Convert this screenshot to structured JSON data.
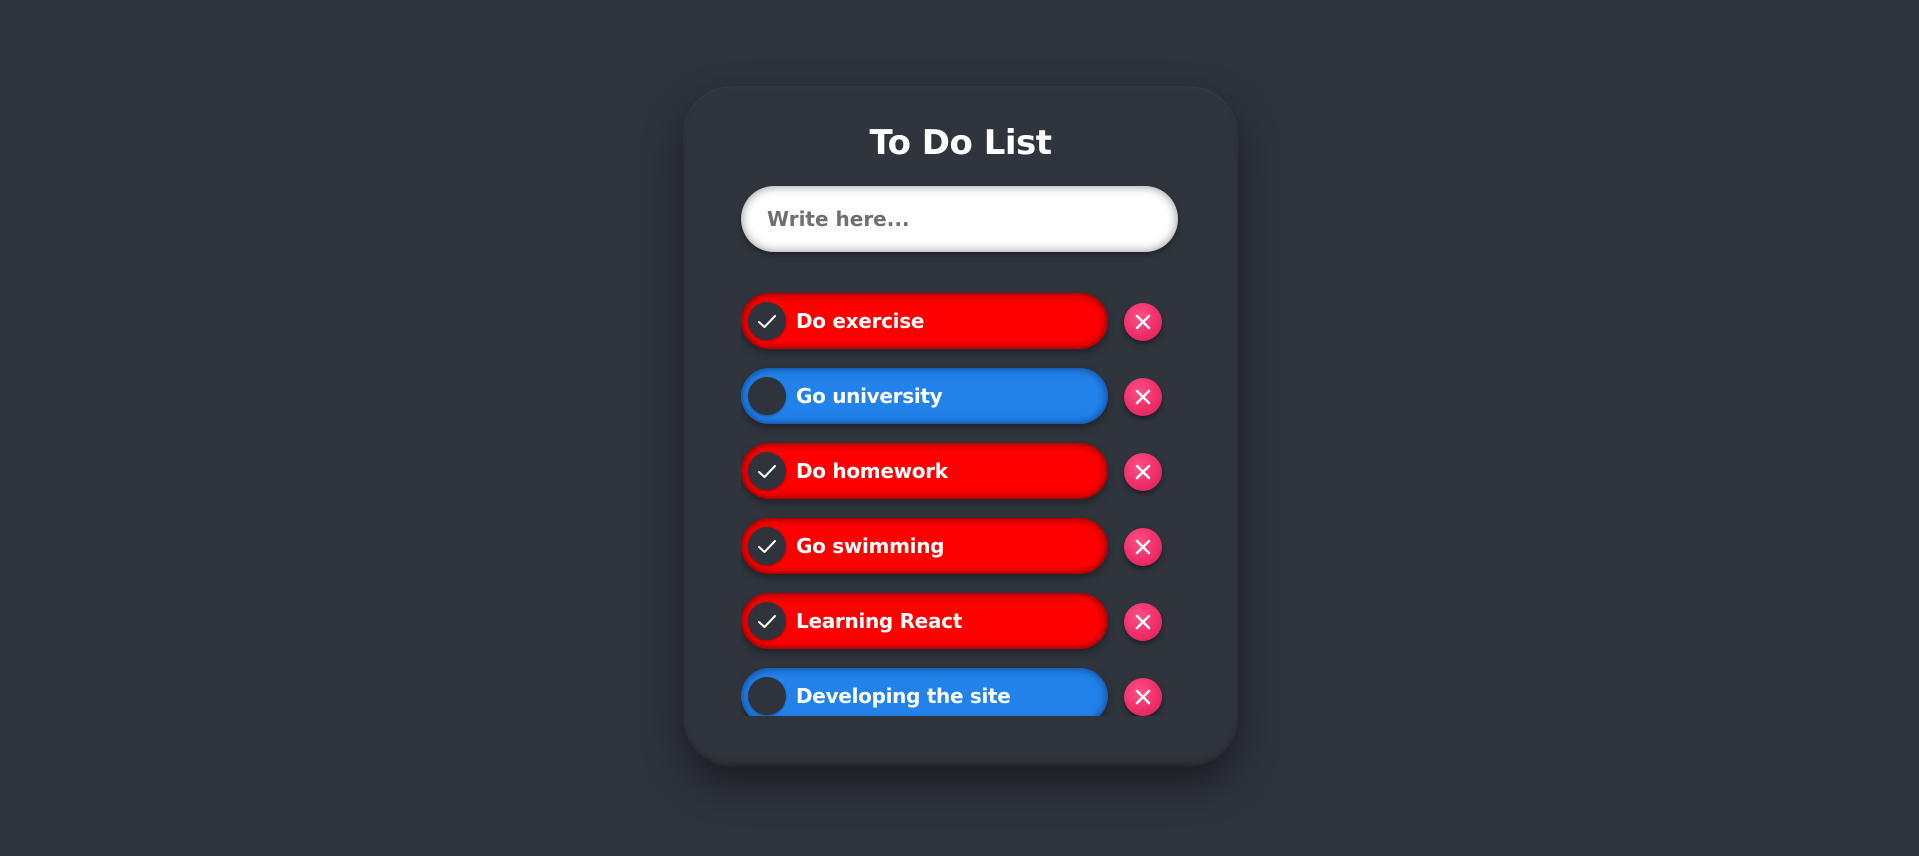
{
  "app": {
    "title": "To Do List"
  },
  "input": {
    "placeholder": "Write here...",
    "value": ""
  },
  "colors": {
    "background": "#2f343c",
    "done": "#ff0000",
    "todo": "#2282ea",
    "delete": "#ef2f6a"
  },
  "tasks": [
    {
      "label": "Do exercise",
      "completed": true
    },
    {
      "label": "Go university",
      "completed": false
    },
    {
      "label": "Do homework",
      "completed": true
    },
    {
      "label": "Go swimming",
      "completed": true
    },
    {
      "label": "Learning React",
      "completed": true
    },
    {
      "label": "Developing the site",
      "completed": false
    }
  ],
  "icons": {
    "check": "checkmark-icon",
    "delete": "close-icon"
  }
}
